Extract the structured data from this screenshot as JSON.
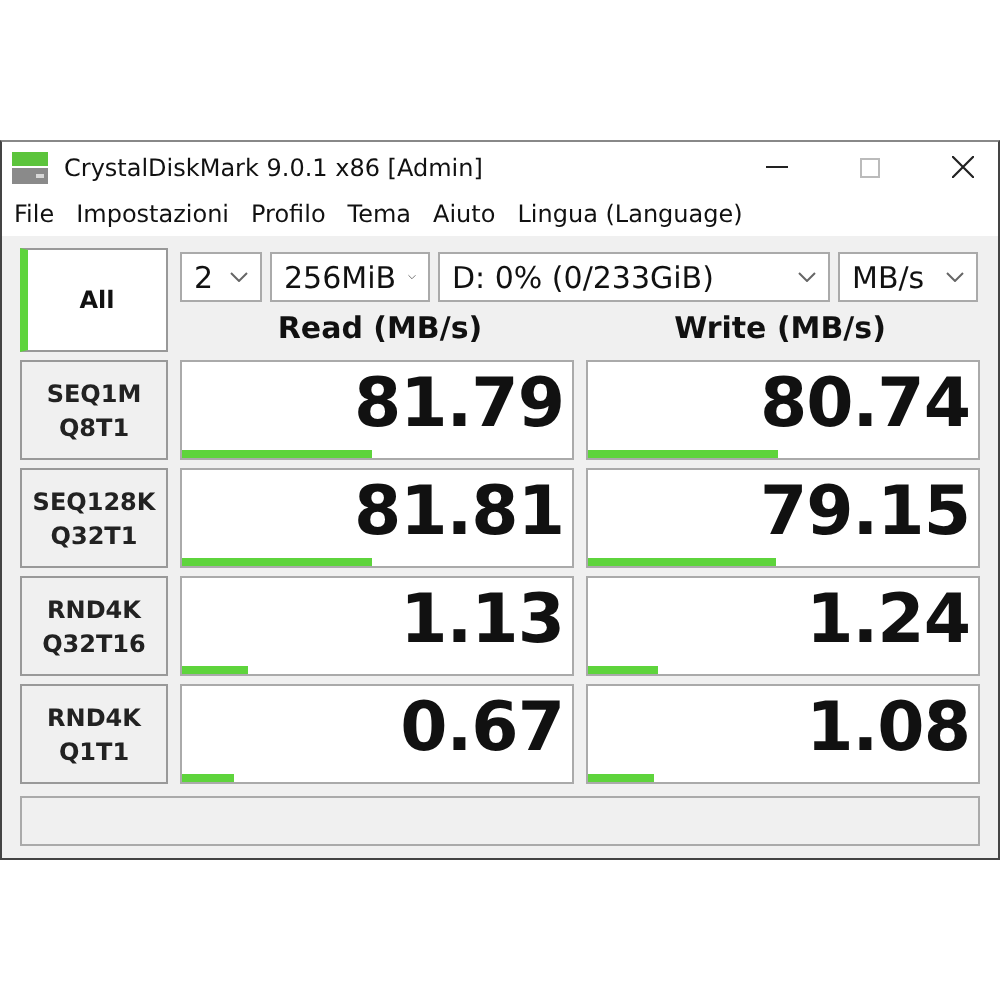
{
  "window": {
    "title": "CrystalDiskMark 9.0.1 x86 [Admin]"
  },
  "menu": [
    "File",
    "Impostazioni",
    "Profilo",
    "Tema",
    "Aiuto",
    "Lingua (Language)"
  ],
  "all_button": {
    "label": "All"
  },
  "selectors": [
    {
      "value": "2"
    },
    {
      "value": "256MiB"
    },
    {
      "value": "D: 0% (0/233GiB)"
    },
    {
      "value": "MB/s"
    }
  ],
  "columns": [
    "Read (MB/s)",
    "Write (MB/s)"
  ],
  "rows": [
    {
      "test": "SEQ1M",
      "params": "Q8T1",
      "read": {
        "value": "81.79",
        "level": 0.485
      },
      "write": {
        "value": "80.74",
        "level": 0.485
      }
    },
    {
      "test": "SEQ128K",
      "params": "Q32T1",
      "read": {
        "value": "81.81",
        "level": 0.485
      },
      "write": {
        "value": "79.15",
        "level": 0.48
      }
    },
    {
      "test": "RND4K",
      "params": "Q32T16",
      "read": {
        "value": "1.13",
        "level": 0.17
      },
      "write": {
        "value": "1.24",
        "level": 0.18
      }
    },
    {
      "test": "RND4K",
      "params": "Q1T1",
      "read": {
        "value": "0.67",
        "level": 0.135
      },
      "write": {
        "value": "1.08",
        "level": 0.17
      }
    }
  ]
}
